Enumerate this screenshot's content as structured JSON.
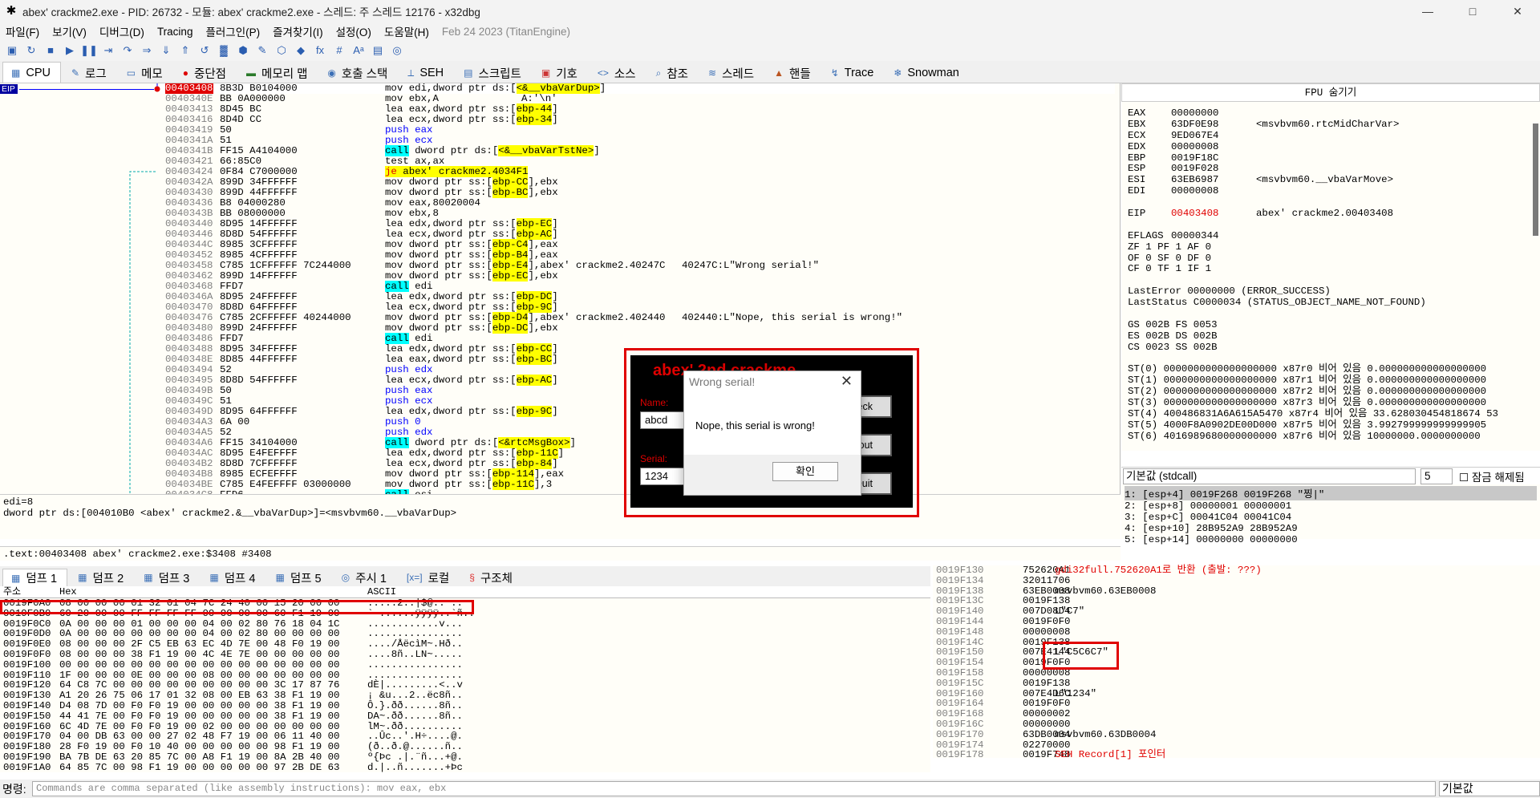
{
  "title": "abex' crackme2.exe - PID: 26732 - 모듈: abex' crackme2.exe - 스레드: 주 스레드 12176 - x32dbg",
  "window_buttons": {
    "min": "—",
    "max": "□",
    "close": "✕"
  },
  "menu": [
    "파일(F)",
    "보기(V)",
    "디버그(D)",
    "Tracing",
    "플러그인(P)",
    "즐겨찾기(I)",
    "설정(O)",
    "도움말(H)"
  ],
  "menu_date": "Feb 24 2023 (TitanEngine)",
  "toolbar_icons": [
    "▣",
    "↻",
    "■",
    "▶",
    "❚❚",
    "⇥",
    "↷",
    "⇒",
    "⇓",
    "⇑",
    "↺",
    "▓",
    "⬢",
    "✎",
    "⬡",
    "◆",
    "fx",
    "#",
    "Aᵃ",
    "▤",
    "◎"
  ],
  "tabs": [
    {
      "icon": "▦",
      "label": "CPU"
    },
    {
      "icon": "✎",
      "label": "로그"
    },
    {
      "icon": "▭",
      "label": "메모"
    },
    {
      "icon": "●",
      "label": "중단점"
    },
    {
      "icon": "▬",
      "label": "메모리 맵"
    },
    {
      "icon": "◉",
      "label": "호출 스택"
    },
    {
      "icon": "⟂",
      "label": "SEH"
    },
    {
      "icon": "▤",
      "label": "스크립트"
    },
    {
      "icon": "▣",
      "label": "기호"
    },
    {
      "icon": "<>",
      "label": "소스"
    },
    {
      "icon": "⌕",
      "label": "참조"
    },
    {
      "icon": "≋",
      "label": "스레드"
    },
    {
      "icon": "▲",
      "label": "핸들"
    },
    {
      "icon": "↯",
      "label": "Trace"
    },
    {
      "icon": "❄",
      "label": "Snowman"
    }
  ],
  "eip_label": "EIP",
  "disasm": [
    {
      "addr": "00403408",
      "bytes": "8B3D B0104000",
      "pre": "mov edi,dword ptr ds:[",
      "mem": "<&__vbaVarDup>",
      "post": "]",
      "cmt": "",
      "kind": "eip"
    },
    {
      "addr": "0040340E",
      "bytes": "BB 0A000000",
      "pre": "mov ebx,A",
      "mem": "",
      "post": "",
      "cmt": "A:'\\n'",
      "kind": ""
    },
    {
      "addr": "00403413",
      "bytes": "8D45 BC",
      "pre": "lea eax,dword ptr ss:[",
      "mem": "ebp-44",
      "post": "]",
      "cmt": "",
      "kind": ""
    },
    {
      "addr": "00403416",
      "bytes": "8D4D CC",
      "pre": "lea ecx,dword ptr ss:[",
      "mem": "ebp-34",
      "post": "]",
      "cmt": "",
      "kind": ""
    },
    {
      "addr": "00403419",
      "bytes": "50",
      "pre": "push eax",
      "mem": "",
      "post": "",
      "cmt": "",
      "kind": "push"
    },
    {
      "addr": "0040341A",
      "bytes": "51",
      "pre": "push ecx",
      "mem": "",
      "post": "",
      "cmt": "",
      "kind": "push"
    },
    {
      "addr": "0040341B",
      "bytes": "FF15 A4104000",
      "pre": "call",
      "pre2": " dword ptr ds:[",
      "mem": "<&__vbaVarTstNe>",
      "post": "]",
      "cmt": "",
      "kind": "call"
    },
    {
      "addr": "00403421",
      "bytes": "66:85C0",
      "pre": "test ax,ax",
      "mem": "",
      "post": "",
      "cmt": "",
      "kind": ""
    },
    {
      "addr": "00403424",
      "bytes": "0F84 C7000000",
      "pre": "je",
      "pre2": " abex' crackme2.4034F1",
      "mem": "",
      "post": "",
      "cmt": "",
      "kind": "jmp"
    },
    {
      "addr": "0040342A",
      "bytes": "899D 34FFFFFF",
      "pre": "mov dword ptr ss:[",
      "mem": "ebp-CC",
      "post": "],ebx",
      "cmt": "",
      "kind": ""
    },
    {
      "addr": "00403430",
      "bytes": "899D 44FFFFFF",
      "pre": "mov dword ptr ss:[",
      "mem": "ebp-BC",
      "post": "],ebx",
      "cmt": "",
      "kind": ""
    },
    {
      "addr": "00403436",
      "bytes": "B8 04000280",
      "pre": "mov eax,80020004",
      "mem": "",
      "post": "",
      "cmt": "",
      "kind": ""
    },
    {
      "addr": "0040343B",
      "bytes": "BB 08000000",
      "pre": "mov ebx,8",
      "mem": "",
      "post": "",
      "cmt": "",
      "kind": ""
    },
    {
      "addr": "00403440",
      "bytes": "8D95 14FFFFFF",
      "pre": "lea edx,dword ptr ss:[",
      "mem": "ebp-EC",
      "post": "]",
      "cmt": "",
      "kind": ""
    },
    {
      "addr": "00403446",
      "bytes": "8D8D 54FFFFFF",
      "pre": "lea ecx,dword ptr ss:[",
      "mem": "ebp-AC",
      "post": "]",
      "cmt": "",
      "kind": ""
    },
    {
      "addr": "0040344C",
      "bytes": "8985 3CFFFFFF",
      "pre": "mov dword ptr ss:[",
      "mem": "ebp-C4",
      "post": "],eax",
      "cmt": "",
      "kind": ""
    },
    {
      "addr": "00403452",
      "bytes": "8985 4CFFFFFF",
      "pre": "mov dword ptr ss:[",
      "mem": "ebp-B4",
      "post": "],eax",
      "cmt": "",
      "kind": ""
    },
    {
      "addr": "00403458",
      "bytes": "C785 1CFFFFFF 7C244000",
      "pre": "mov dword ptr ss:[",
      "mem": "ebp-E4",
      "post": "],abex' crackme2.40247C",
      "cmt": "40247C:L\"Wrong serial!\"",
      "kind": ""
    },
    {
      "addr": "00403462",
      "bytes": "899D 14FFFFFF",
      "pre": "mov dword ptr ss:[",
      "mem": "ebp-EC",
      "post": "],ebx",
      "cmt": "",
      "kind": ""
    },
    {
      "addr": "00403468",
      "bytes": "FFD7",
      "pre": "call",
      "pre2": " edi",
      "mem": "",
      "post": "",
      "cmt": "",
      "kind": "call"
    },
    {
      "addr": "0040346A",
      "bytes": "8D95 24FFFFFF",
      "pre": "lea edx,dword ptr ss:[",
      "mem": "ebp-DC",
      "post": "]",
      "cmt": "",
      "kind": ""
    },
    {
      "addr": "00403470",
      "bytes": "8D8D 64FFFFFF",
      "pre": "lea ecx,dword ptr ss:[",
      "mem": "ebp-9C",
      "post": "]",
      "cmt": "",
      "kind": ""
    },
    {
      "addr": "00403476",
      "bytes": "C785 2CFFFFFF 40244000",
      "pre": "mov dword ptr ss:[",
      "mem": "ebp-D4",
      "post": "],abex' crackme2.402440",
      "cmt": "402440:L\"Nope, this serial is wrong!\"",
      "kind": ""
    },
    {
      "addr": "00403480",
      "bytes": "899D 24FFFFFF",
      "pre": "mov dword ptr ss:[",
      "mem": "ebp-DC",
      "post": "],ebx",
      "cmt": "",
      "kind": ""
    },
    {
      "addr": "00403486",
      "bytes": "FFD7",
      "pre": "call",
      "pre2": " edi",
      "mem": "",
      "post": "",
      "cmt": "",
      "kind": "call"
    },
    {
      "addr": "00403488",
      "bytes": "8D95 34FFFFFF",
      "pre": "lea edx,dword ptr ss:[",
      "mem": "ebp-CC",
      "post": "]",
      "cmt": "",
      "kind": ""
    },
    {
      "addr": "0040348E",
      "bytes": "8D85 44FFFFFF",
      "pre": "lea eax,dword ptr ss:[",
      "mem": "ebp-BC",
      "post": "]",
      "cmt": "",
      "kind": ""
    },
    {
      "addr": "00403494",
      "bytes": "52",
      "pre": "push edx",
      "mem": "",
      "post": "",
      "cmt": "",
      "kind": "push"
    },
    {
      "addr": "00403495",
      "bytes": "8D8D 54FFFFFF",
      "pre": "lea ecx,dword ptr ss:[",
      "mem": "ebp-AC",
      "post": "]",
      "cmt": "",
      "kind": ""
    },
    {
      "addr": "0040349B",
      "bytes": "50",
      "pre": "push eax",
      "mem": "",
      "post": "",
      "cmt": "",
      "kind": "push"
    },
    {
      "addr": "0040349C",
      "bytes": "51",
      "pre": "push ecx",
      "mem": "",
      "post": "",
      "cmt": "",
      "kind": "push"
    },
    {
      "addr": "0040349D",
      "bytes": "8D95 64FFFFFF",
      "pre": "lea edx,dword ptr ss:[",
      "mem": "ebp-9C",
      "post": "]",
      "cmt": "",
      "kind": ""
    },
    {
      "addr": "004034A3",
      "bytes": "6A 00",
      "pre": "push 0",
      "mem": "",
      "post": "",
      "cmt": "",
      "kind": "push"
    },
    {
      "addr": "004034A5",
      "bytes": "52",
      "pre": "push edx",
      "mem": "",
      "post": "",
      "cmt": "",
      "kind": "push"
    },
    {
      "addr": "004034A6",
      "bytes": "FF15 34104000",
      "pre": "call",
      "pre2": " dword ptr ds:[",
      "mem": "<&rtcMsgBox>",
      "post": "]",
      "cmt": "",
      "kind": "call"
    },
    {
      "addr": "004034AC",
      "bytes": "8D95 E4FEFFFF",
      "pre": "lea edx,dword ptr ss:[",
      "mem": "ebp-11C",
      "post": "]",
      "cmt": "",
      "kind": ""
    },
    {
      "addr": "004034B2",
      "bytes": "8D8D 7CFFFFFF",
      "pre": "lea ecx,dword ptr ss:[",
      "mem": "ebp-84",
      "post": "]",
      "cmt": "",
      "kind": ""
    },
    {
      "addr": "004034B8",
      "bytes": "8985 ECFEFFFF",
      "pre": "mov dword ptr ss:[",
      "mem": "ebp-114",
      "post": "],eax",
      "cmt": "",
      "kind": ""
    },
    {
      "addr": "004034BE",
      "bytes": "C785 E4FEFFFF 03000000",
      "pre": "mov dword ptr ss:[",
      "mem": "ebp-11C",
      "post": "],3",
      "cmt": "",
      "kind": ""
    },
    {
      "addr": "004034C8",
      "bytes": "FFD6",
      "pre": "call",
      "pre2": " esi",
      "mem": "",
      "post": "",
      "cmt": "",
      "kind": "call"
    }
  ],
  "fpu_header": "FPU 숨기기",
  "registers": [
    {
      "n": "EAX",
      "v": "00000000",
      "c": ""
    },
    {
      "n": "EBX",
      "v": "63DF0E98",
      "c": "<msvbvm60.rtcMidCharVar>"
    },
    {
      "n": "ECX",
      "v": "9ED067E4",
      "c": ""
    },
    {
      "n": "EDX",
      "v": "00000008",
      "c": ""
    },
    {
      "n": "EBP",
      "v": "0019F18C",
      "c": ""
    },
    {
      "n": "ESP",
      "v": "0019F028",
      "c": ""
    },
    {
      "n": "ESI",
      "v": "63EB6987",
      "c": "<msvbvm60.__vbaVarMove>"
    },
    {
      "n": "EDI",
      "v": "00000008",
      "c": ""
    },
    {
      "n": "",
      "v": "",
      "c": ""
    },
    {
      "n": "EIP",
      "v": "00403408",
      "c": "abex' crackme2.00403408"
    },
    {
      "n": "",
      "v": "",
      "c": ""
    },
    {
      "n": "EFLAGS",
      "v": "   00000344",
      "c": ""
    },
    {
      "n": "ZF 1  PF 1  AF 0",
      "v": "",
      "c": ""
    },
    {
      "n": "OF 0  SF 0  DF 0",
      "v": "",
      "c": ""
    },
    {
      "n": "CF 0  TF 1  IF 1",
      "v": "",
      "c": ""
    },
    {
      "n": "",
      "v": "",
      "c": ""
    },
    {
      "n": "LastError  00000000 (ERROR_SUCCESS)",
      "v": "",
      "c": ""
    },
    {
      "n": "LastStatus C0000034 (STATUS_OBJECT_NAME_NOT_FOUND)",
      "v": "",
      "c": ""
    },
    {
      "n": "",
      "v": "",
      "c": ""
    },
    {
      "n": "GS 002B  FS 0053",
      "v": "",
      "c": ""
    },
    {
      "n": "ES 002B  DS 002B",
      "v": "",
      "c": ""
    },
    {
      "n": "CS 0023  SS 002B",
      "v": "",
      "c": ""
    },
    {
      "n": "",
      "v": "",
      "c": ""
    },
    {
      "n": "ST(0) 0000000000000000000 x87r0 비어 있음 0.000000000000000000",
      "v": "",
      "c": ""
    },
    {
      "n": "ST(1) 0000000000000000000 x87r1 비어 있음 0.000000000000000000",
      "v": "",
      "c": ""
    },
    {
      "n": "ST(2) 0000000000000000000 x87r2 비어 있음 0.000000000000000000",
      "v": "",
      "c": ""
    },
    {
      "n": "ST(3) 0000000000000000000 x87r3 비어 있음 0.000000000000000000",
      "v": "",
      "c": ""
    },
    {
      "n": "ST(4) 400486831A6A615A5470 x87r4 비어 있음 33.628030454818674 53",
      "v": "",
      "c": ""
    },
    {
      "n": "ST(5) 4000F8A0902DE00D000 x87r5 비어 있음 3.992799999999999905",
      "v": "",
      "c": ""
    },
    {
      "n": "ST(6) 4016989680000000000 x87r6 비어 있음 10000000.0000000000",
      "v": "",
      "c": ""
    }
  ],
  "callconv": "기본값 (stdcall)",
  "argcount": "5",
  "lock_label": "잠금 해제됨",
  "callstack": [
    "1: [esp+4]  0019F268 0019F268 \"찡|\"",
    "2: [esp+8]  00000001 00000001",
    "3: [esp+C]  00041C04 00041C04",
    "4: [esp+10] 28B952A9 28B952A9",
    "5: [esp+14] 00000000 00000000"
  ],
  "info_lines": [
    "edi=8",
    "dword ptr ds:[004010B0 <abex' crackme2.&__vbaVarDup>]=<msvbvm60.__vbaVarDup>"
  ],
  "info_addr": ".text:00403408 abex' crackme2.exe:$3408 #3408",
  "dump_tabs": [
    {
      "icon": "▦",
      "label": "덤프 1"
    },
    {
      "icon": "▦",
      "label": "덤프 2"
    },
    {
      "icon": "▦",
      "label": "덤프 3"
    },
    {
      "icon": "▦",
      "label": "덤프 4"
    },
    {
      "icon": "▦",
      "label": "덤프 5"
    },
    {
      "icon": "◎",
      "label": "주시 1"
    },
    {
      "icon": "[x=]",
      "label": "로컬"
    },
    {
      "icon": "§",
      "label": "구조체"
    }
  ],
  "dump_header": {
    "addr": "주소",
    "hex": "Hex",
    "ascii": "ASCII"
  },
  "dump_rows": [
    {
      "a": "0019F0A0",
      "h": "08 00 00 00 01 32 01 04 7C 24 40 00 15 20 00 00",
      "t": ".....2..|$@.. .."
    },
    {
      "a": "0019F0B0",
      "h": "60 20 00 00 FF FF FF FF 00 00 00 00 60 F1 19 00",
      "t": "` ......ÿÿÿÿ..`ñ.."
    },
    {
      "a": "0019F0C0",
      "h": "0A 00 00 00 01 00 00 00 04 00 02 80 76 18 04 1C",
      "t": "............v..."
    },
    {
      "a": "0019F0D0",
      "h": "0A 00 00 00 00 00 00 00 04 00 02 80 00 00 00 00",
      "t": "................"
    },
    {
      "a": "0019F0E0",
      "h": "08 00 00 00 2F C5 EB 63 EC 4D 7E 00 48 F0 19 00",
      "t": "..../ÅëcìM~.Hð.."
    },
    {
      "a": "0019F0F0",
      "h": "08 00 00 00 38 F1 19 00 4C 4E 7E 00 00 00 00 00",
      "t": "....8ñ..LN~....."
    },
    {
      "a": "0019F100",
      "h": "00 00 00 00 00 00 00 00 00 00 00 00 00 00 00 00",
      "t": "................"
    },
    {
      "a": "0019F110",
      "h": "1F 00 00 00 0E 00 00 00 08 00 00 00 00 00 00 00",
      "t": "................"
    },
    {
      "a": "0019F120",
      "h": "64 C8 7C 00 00 00 00 00 00 00 00 00 3C 17 87 76",
      "t": "dÈ|.........<..v"
    },
    {
      "a": "0019F130",
      "h": "A1 20 26 75 06 17 01 32 08 00 EB 63 38 F1 19 00",
      "t": "¡ &u...2..ëc8ñ.."
    },
    {
      "a": "0019F140",
      "h": "D4 08 7D 00 F0 F0 19 00 00 00 00 00 38 F1 19 00",
      "t": "Ô.}.ðð......8ñ.."
    },
    {
      "a": "0019F150",
      "h": "44 41 7E 00 F0 F0 19 00 00 00 00 00 38 F1 19 00",
      "t": "DA~.ðð......8ñ.."
    },
    {
      "a": "0019F160",
      "h": "6C 4D 7E 00 F0 F0 19 00 02 00 00 00 00 00 00 00",
      "t": "lM~.ðð.........."
    },
    {
      "a": "0019F170",
      "h": "04 00 DB 63 00 00 27 02 48 F7 19 00 06 11 40 00",
      "t": "..Ûc..'.H÷....@."
    },
    {
      "a": "0019F180",
      "h": "28 F0 19 00 F0 10 40 00 00 00 00 00 98 F1 19 00",
      "t": "(ð..ð.@......ñ.."
    },
    {
      "a": "0019F190",
      "h": "BA 7B DE 63 20 85 7C 00 A8 F1 19 00 8A 2B 40 00",
      "t": "º{Þc .|.¨ñ...+@."
    },
    {
      "a": "0019F1A0",
      "h": "64 85 7C 00 98 F1 19 00 00 00 00 00 97 2B DE 63",
      "t": "d.|..ñ.......+Þc"
    }
  ],
  "stack_rows": [
    {
      "a": "0019F130",
      "v": "752620A1",
      "c": "gdi32full.752620A1로 반환 (출발: ???)",
      "red": true
    },
    {
      "a": "0019F134",
      "v": "32011706",
      "c": ""
    },
    {
      "a": "0019F138",
      "v": "63EB0008",
      "c": "msvbvm60.63EB0008"
    },
    {
      "a": "0019F13C",
      "v": "0019F138",
      "c": ""
    },
    {
      "a": "0019F140",
      "v": "007D08D4",
      "c": "L\"C7\""
    },
    {
      "a": "0019F144",
      "v": "0019F0F0",
      "c": ""
    },
    {
      "a": "0019F148",
      "v": "00000008",
      "c": ""
    },
    {
      "a": "0019F14C",
      "v": "0019F138",
      "c": ""
    },
    {
      "a": "0019F150",
      "v": "007E4144",
      "c": "L\"C5C6C7\""
    },
    {
      "a": "0019F154",
      "v": "0019F0F0",
      "c": ""
    },
    {
      "a": "0019F158",
      "v": "00000008",
      "c": ""
    },
    {
      "a": "0019F15C",
      "v": "0019F138",
      "c": ""
    },
    {
      "a": "0019F160",
      "v": "007E4D6C",
      "c": "L\"1234\""
    },
    {
      "a": "0019F164",
      "v": "0019F0F0",
      "c": ""
    },
    {
      "a": "0019F168",
      "v": "00000002",
      "c": ""
    },
    {
      "a": "0019F16C",
      "v": "00000000",
      "c": ""
    },
    {
      "a": "0019F170",
      "v": "63DB0004",
      "c": "msvbvm60.63DB0004"
    },
    {
      "a": "0019F174",
      "v": "02270000",
      "c": ""
    },
    {
      "a": "0019F178",
      "v": "0019F748",
      "c": "SEH Record[1] 포인터",
      "red": true
    }
  ],
  "cmd_label": "명령:",
  "cmd_placeholder": "Commands are comma separated (like assembly instructions): mov eax, ebx",
  "cmd_combo": "기본값",
  "crackme": {
    "title": "abex' 2nd crackme",
    "name_label": "Name:",
    "name_value": "abcd",
    "serial_label": "Serial:",
    "serial_value": "1234",
    "btn_check": "Check",
    "btn_about": "About",
    "btn_quit": "Quit"
  },
  "msgbox": {
    "title": "Wrong serial!",
    "text": "Nope, this serial is wrong!",
    "ok": "확인",
    "close": "✕"
  },
  "colors": {
    "accent": "#0000a0",
    "highlight_red": "#e00000",
    "call_bg": "#00ffff",
    "mem_bg": "#ffff00"
  }
}
